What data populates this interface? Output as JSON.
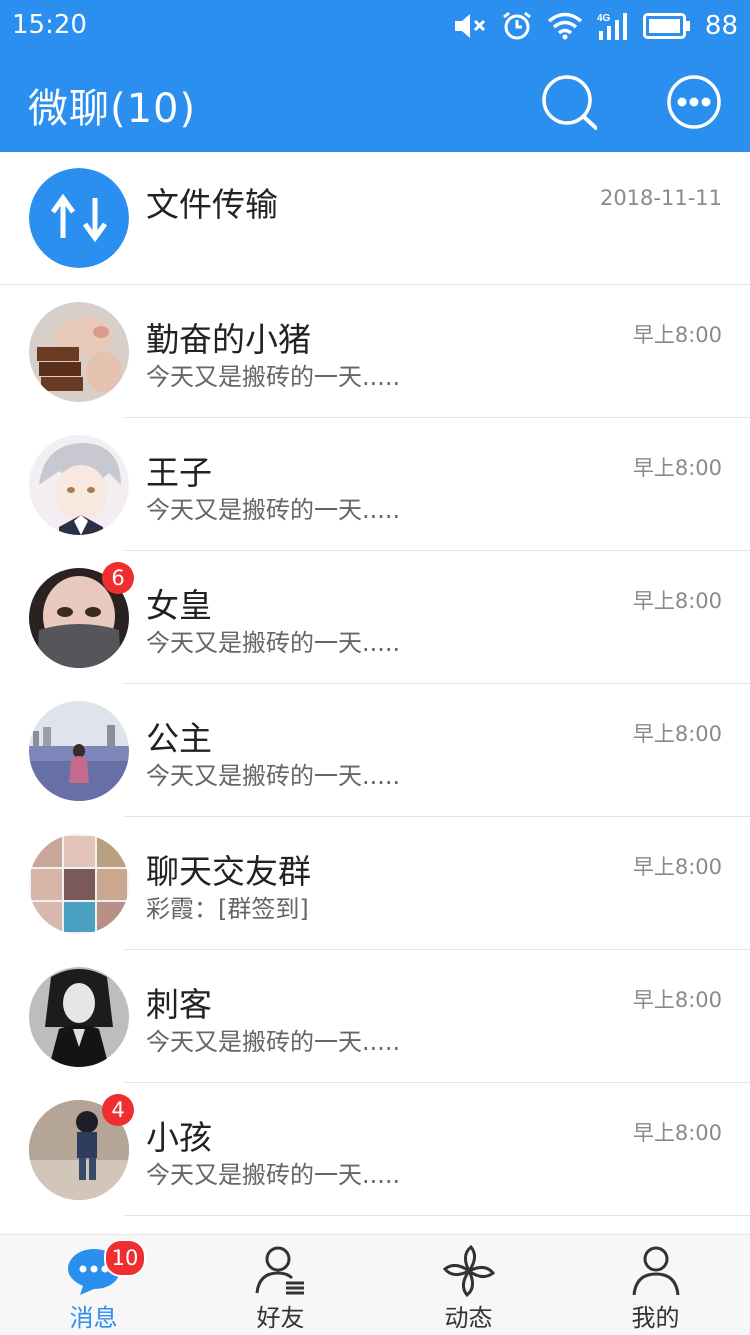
{
  "status": {
    "time": "15:20",
    "battery": "88",
    "icons": [
      "mute-icon",
      "alarm-icon",
      "wifi-icon",
      "signal-4g-icon",
      "battery-icon"
    ]
  },
  "header": {
    "title": "微聊(10)",
    "actions": [
      "search-icon",
      "more-icon"
    ]
  },
  "conversations": [
    {
      "name": "文件传输",
      "message": "",
      "time": "2018-11-11",
      "badge": "",
      "avatar": "file-transfer-icon",
      "color": "#2b8ff0"
    },
    {
      "name": "勤奋的小猪",
      "message": "今天又是搬砖的一天.....",
      "time": "早上8:00",
      "badge": "",
      "avatar": "pig-photo"
    },
    {
      "name": "王子",
      "message": "今天又是搬砖的一天.....",
      "time": "早上8:00",
      "badge": "",
      "avatar": "anime-boy-photo"
    },
    {
      "name": "女皇",
      "message": "今天又是搬砖的一天.....",
      "time": "早上8:00",
      "badge": "6",
      "avatar": "masked-girl-photo"
    },
    {
      "name": "公主",
      "message": "今天又是搬砖的一天.....",
      "time": "早上8:00",
      "badge": "",
      "avatar": "pool-girl-photo"
    },
    {
      "name": "聊天交友群",
      "message": "彩霞：[群签到]",
      "time": "早上8:00",
      "badge": "",
      "avatar": "group-grid-photo"
    },
    {
      "name": "刺客",
      "message": "今天又是搬砖的一天.....",
      "time": "早上8:00",
      "badge": "",
      "avatar": "bw-girl-photo"
    },
    {
      "name": "小孩",
      "message": "今天又是搬砖的一天.....",
      "time": "早上8:00",
      "badge": "4",
      "avatar": "child-photo"
    }
  ],
  "tabs": [
    {
      "label": "消息",
      "icon": "chat-bubble-icon",
      "badge": "10",
      "active": true
    },
    {
      "label": "好友",
      "icon": "friends-icon",
      "badge": "",
      "active": false
    },
    {
      "label": "动态",
      "icon": "pinwheel-icon",
      "badge": "",
      "active": false
    },
    {
      "label": "我的",
      "icon": "profile-icon",
      "badge": "",
      "active": false
    }
  ],
  "colors": {
    "accent": "#2b8ff0",
    "badge": "#ef2f2f",
    "divider": "#e4e4e4"
  }
}
